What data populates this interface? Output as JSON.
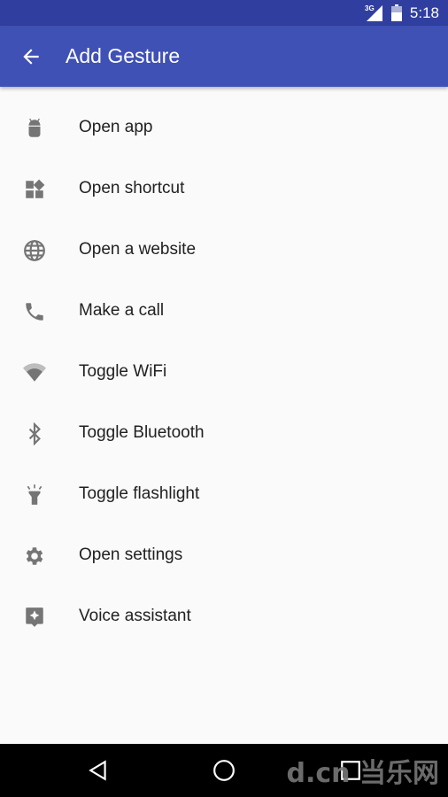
{
  "status_bar": {
    "network": "3G",
    "time": "5:18"
  },
  "app_bar": {
    "title": "Add Gesture",
    "back_icon": "arrow-left-icon"
  },
  "items": [
    {
      "label": "Open app",
      "icon": "android-icon"
    },
    {
      "label": "Open shortcut",
      "icon": "widgets-icon"
    },
    {
      "label": "Open a website",
      "icon": "globe-icon"
    },
    {
      "label": "Make a call",
      "icon": "phone-icon"
    },
    {
      "label": "Toggle WiFi",
      "icon": "wifi-icon"
    },
    {
      "label": "Toggle Bluetooth",
      "icon": "bluetooth-icon"
    },
    {
      "label": "Toggle flashlight",
      "icon": "flashlight-icon"
    },
    {
      "label": "Open settings",
      "icon": "gear-icon"
    },
    {
      "label": "Voice assistant",
      "icon": "assistant-icon"
    }
  ],
  "watermark": "d.cn 当乐网",
  "colors": {
    "primary": "#3f51b5",
    "primary_dark": "#303f9f",
    "icon": "#757575"
  }
}
